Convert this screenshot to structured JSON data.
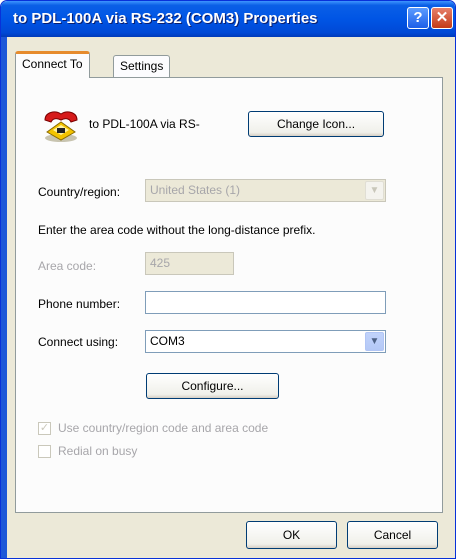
{
  "window": {
    "title": "to PDL-100A via RS-232 (COM3) Properties",
    "help_glyph": "?",
    "close_glyph": "✕"
  },
  "tabs": [
    {
      "label": "Connect To",
      "active": true
    },
    {
      "label": "Settings",
      "active": false
    }
  ],
  "connection": {
    "icon": "telephone-icon",
    "name": "to PDL-100A via RS-",
    "change_icon_label": "Change Icon..."
  },
  "country": {
    "label": "Country/region:",
    "value": "United States (1)"
  },
  "instruction": "Enter the area code without the long-distance prefix.",
  "area_code": {
    "label": "Area code:",
    "value": "425"
  },
  "phone": {
    "label": "Phone number:",
    "value": ""
  },
  "connect_using": {
    "label": "Connect using:",
    "value": "COM3"
  },
  "configure_label": "Configure...",
  "checkboxes": {
    "use_country": {
      "label": "Use country/region code and area code",
      "checked": true
    },
    "redial": {
      "label": "Redial on busy",
      "checked": false
    }
  },
  "buttons": {
    "ok": "OK",
    "cancel": "Cancel"
  },
  "colors": {
    "title_bar": "#0055e5",
    "dialog_bg": "#ece9d8",
    "tab_highlight": "#e68b2c",
    "disabled_text": "#a7a6aa"
  }
}
